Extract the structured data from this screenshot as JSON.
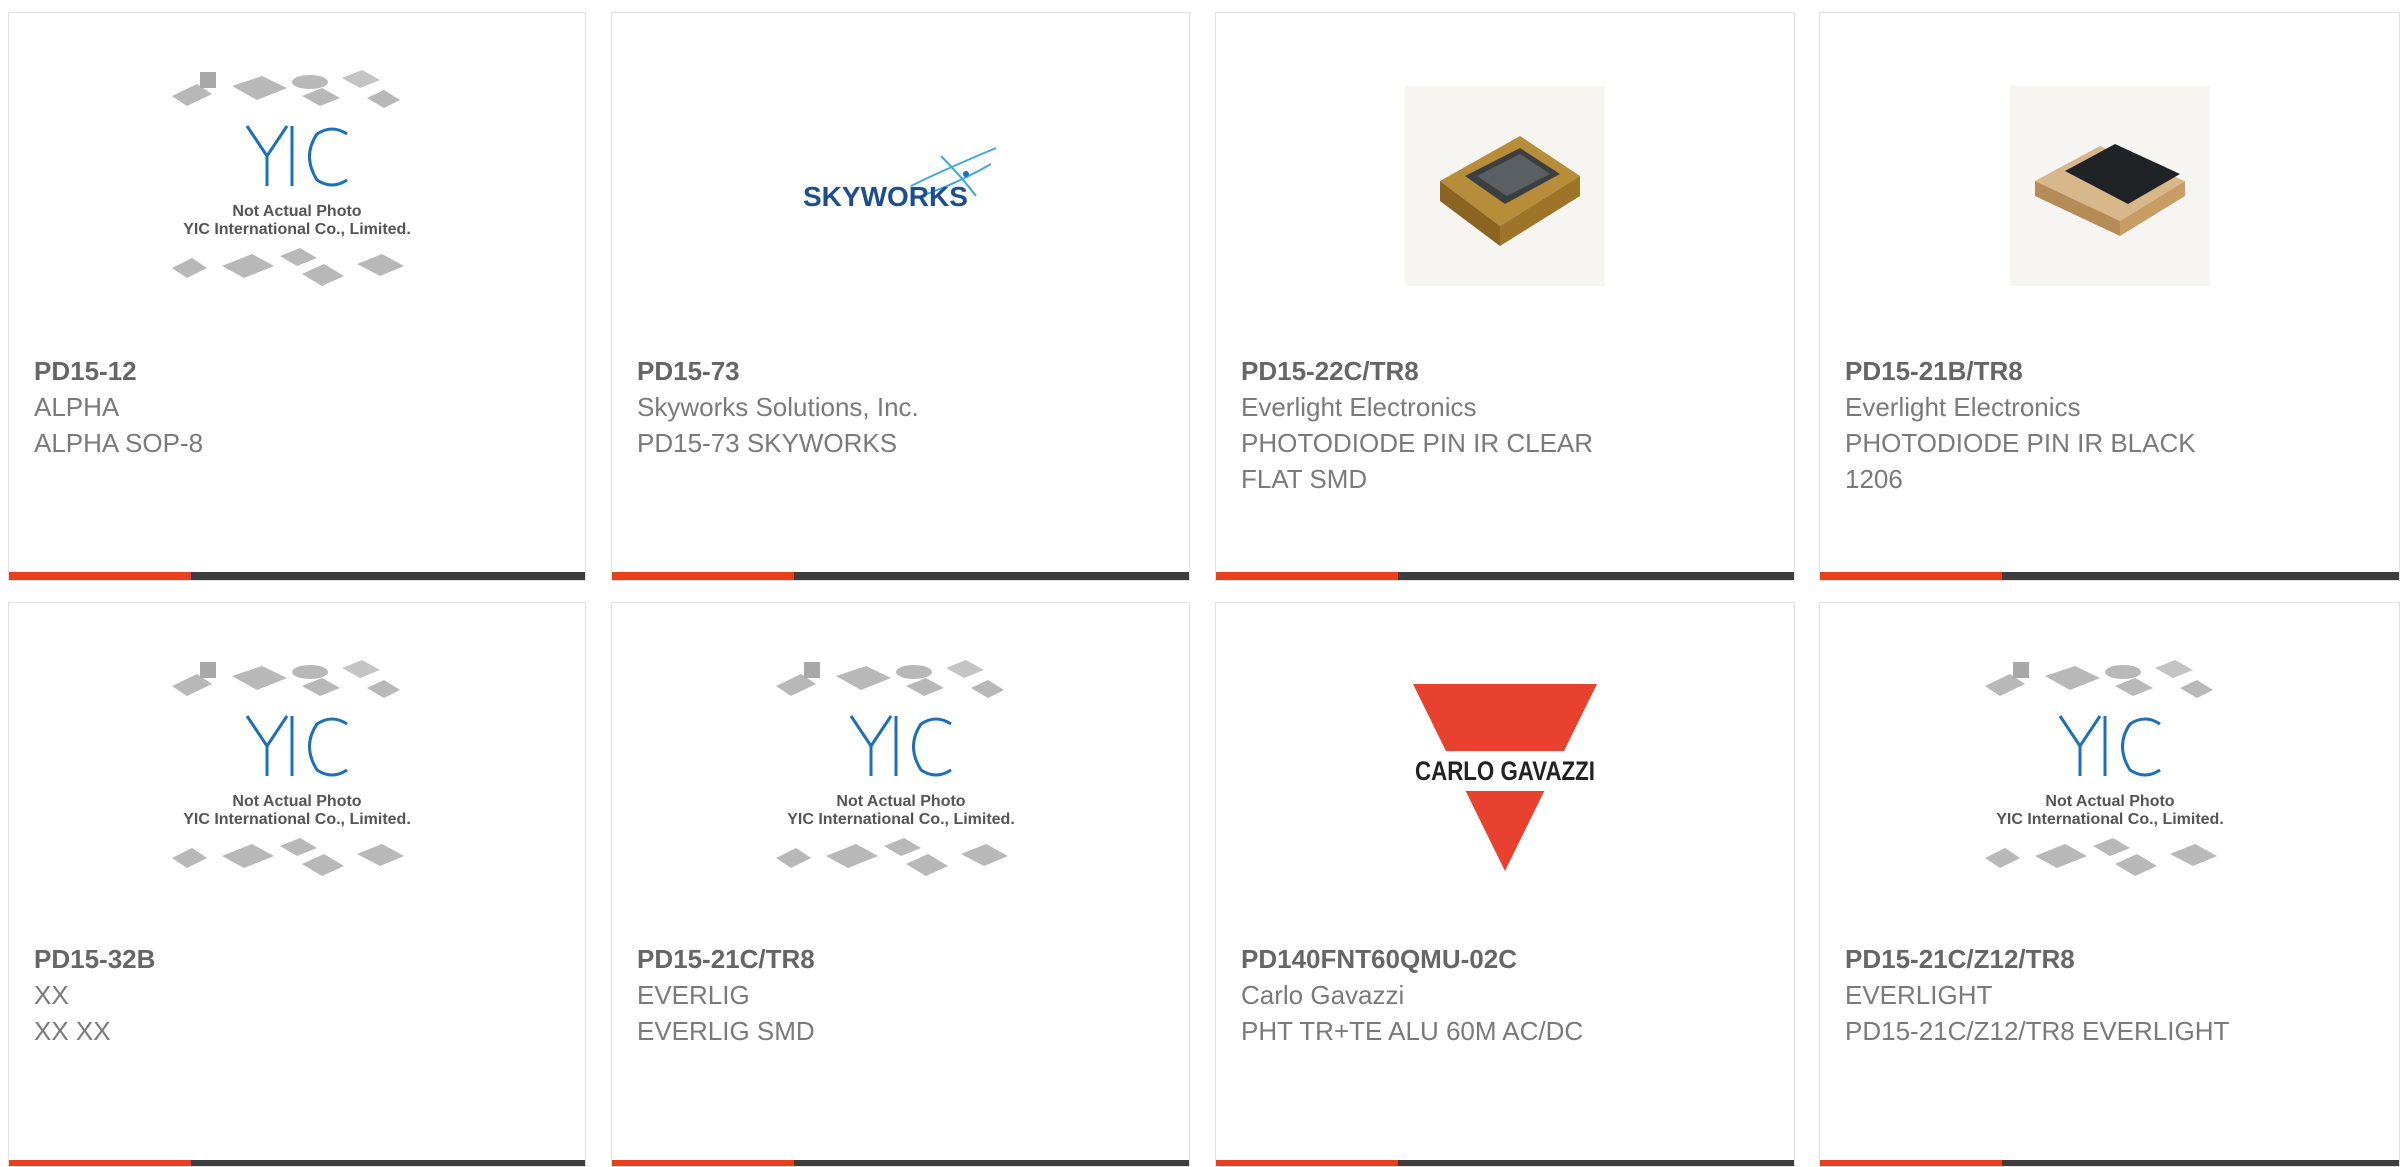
{
  "products": [
    {
      "part_number": "PD15-12",
      "manufacturer": "ALPHA",
      "description": "ALPHA SOP-8",
      "image": "yic-placeholder"
    },
    {
      "part_number": "PD15-73",
      "manufacturer": "Skyworks Solutions, Inc.",
      "description": "PD15-73 SKYWORKS",
      "image": "skyworks-logo"
    },
    {
      "part_number": "PD15-22C/TR8",
      "manufacturer": "Everlight Electronics",
      "description": "PHOTODIODE PIN IR CLEAR FLAT SMD",
      "image": "photodiode-clear"
    },
    {
      "part_number": "PD15-21B/TR8",
      "manufacturer": "Everlight Electronics",
      "description": "PHOTODIODE PIN IR BLACK 1206",
      "image": "photodiode-black"
    },
    {
      "part_number": "PD15-32B",
      "manufacturer": "XX",
      "description": "XX XX",
      "image": "yic-placeholder"
    },
    {
      "part_number": "PD15-21C/TR8",
      "manufacturer": "EVERLIG",
      "description": "EVERLIG SMD",
      "image": "yic-placeholder"
    },
    {
      "part_number": "PD140FNT60QMU-02C",
      "manufacturer": "Carlo Gavazzi",
      "description": "PHT TR+TE ALU 60M AC/DC",
      "image": "carlo-gavazzi-logo"
    },
    {
      "part_number": "PD15-21C/Z12/TR8",
      "manufacturer": "EVERLIGHT",
      "description": "PD15-21C/Z12/TR8 EVERLIGHT",
      "image": "yic-placeholder"
    }
  ],
  "placeholder": {
    "line1": "Not Actual Photo",
    "line2": "YIC International Co., Limited.",
    "logo": "YIC"
  },
  "skyworks": {
    "logo": "SKYWORKS"
  },
  "carlo": {
    "logo": "CARLO GAVAZZI"
  },
  "colors": {
    "accent": "#e8401c",
    "bar": "#3d3d3d",
    "yic_blue": "#1d6fb8",
    "carlo_red": "#e8412f"
  }
}
